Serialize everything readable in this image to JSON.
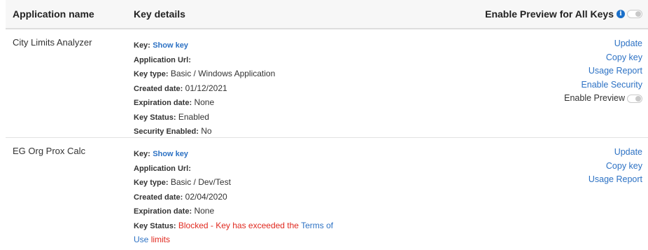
{
  "header": {
    "col_name": "Application name",
    "col_details": "Key details",
    "preview_all_label": "Enable Preview for All Keys",
    "info_icon": "i"
  },
  "labels": {
    "key": "Key:",
    "application_url": "Application Url:",
    "key_type": "Key type:",
    "created_date": "Created date:",
    "expiration_date": "Expiration date:",
    "key_status": "Key Status:",
    "security_enabled": "Security Enabled:"
  },
  "rows": [
    {
      "name": "City Limits Analyzer",
      "show_key": "Show key",
      "key_type": "Basic / Windows Application",
      "created": "01/12/2021",
      "expiration": "None",
      "status": "Enabled",
      "security": "No",
      "actions": {
        "update": "Update",
        "copy": "Copy key",
        "usage": "Usage Report",
        "security": "Enable Security",
        "preview": "Enable Preview"
      }
    },
    {
      "name": "EG Org Prox Calc",
      "show_key": "Show key",
      "key_type": "Basic / Dev/Test",
      "created": "02/04/2020",
      "expiration": "None",
      "status_red_1": "Blocked - Key has exceeded the",
      "status_link_1": "Terms of",
      "status_link_2": "Use",
      "status_red_2": "limits",
      "actions": {
        "update": "Update",
        "copy": "Copy key",
        "usage": "Usage Report"
      }
    }
  ],
  "colors": {
    "link": "#2d72c4",
    "error": "#e0291f",
    "header_bg": "#f7f7f7"
  }
}
